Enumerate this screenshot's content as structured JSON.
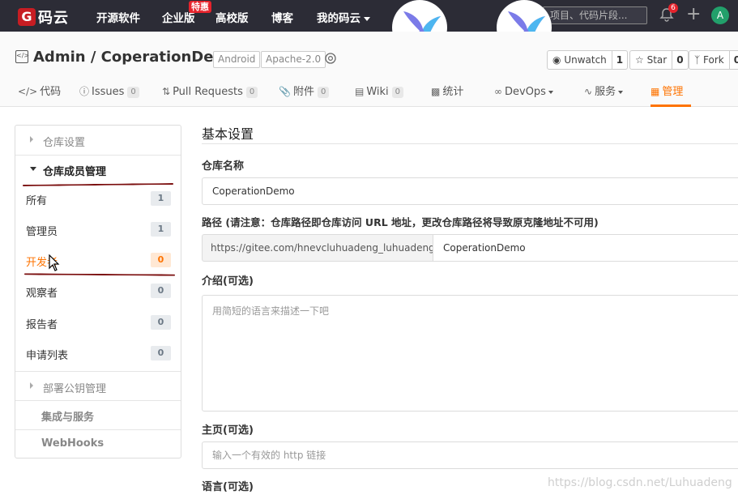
{
  "topnav": {
    "logo_mark": "G",
    "logo_text": "码云",
    "items": [
      "开源软件",
      "企业版",
      "高校版",
      "博客",
      "我的码云"
    ],
    "special_badge": "特惠",
    "search_placeholder": "项目、代码片段...",
    "notifications": "6",
    "avatar": "A"
  },
  "repo": {
    "title": "Admin / CoperationDemo",
    "tags": [
      "Android",
      "Apache-2.0"
    ],
    "actions": [
      {
        "label": "Unwatch",
        "count": "1"
      },
      {
        "label": "Star",
        "count": "0"
      },
      {
        "label": "Fork",
        "count": "0"
      }
    ]
  },
  "tabs": [
    {
      "label": "代码",
      "count": ""
    },
    {
      "label": "Issues",
      "count": "0"
    },
    {
      "label": "Pull Requests",
      "count": "0"
    },
    {
      "label": "附件",
      "count": "0"
    },
    {
      "label": "Wiki",
      "count": "0"
    },
    {
      "label": "统计",
      "count": ""
    },
    {
      "label": "DevOps",
      "count": ""
    },
    {
      "label": "服务",
      "count": ""
    },
    {
      "label": "管理",
      "count": ""
    }
  ],
  "sidebar": {
    "repo_settings": "仓库设置",
    "member_mgmt": "仓库成员管理",
    "members": [
      {
        "label": "所有",
        "count": "1"
      },
      {
        "label": "管理员",
        "count": "1"
      },
      {
        "label": "开发者",
        "count": "0"
      },
      {
        "label": "观察者",
        "count": "0"
      },
      {
        "label": "报告者",
        "count": "0"
      },
      {
        "label": "申请列表",
        "count": "0"
      }
    ],
    "deploy_keys": "部署公钥管理",
    "integrations": "集成与服务",
    "webhooks": "WebHooks"
  },
  "form": {
    "section_title": "基本设置",
    "name_label": "仓库名称",
    "name_value": "CoperationDemo",
    "path_label": "路径 (请注意：仓库路径即仓库访问 URL 地址，更改仓库路径将导致原克隆地址不可用)",
    "path_prefix": "https://gitee.com/hnevcluhuadeng_luhuadeng/",
    "path_value": "CoperationDemo",
    "desc_label": "介绍(可选)",
    "desc_placeholder": "用简短的语言来描述一下吧",
    "homepage_label": "主页(可选)",
    "homepage_placeholder": "输入一个有效的 http 链接",
    "language_label": "语言(可选)"
  },
  "watermark": "https://blog.csdn.net/Luhuadeng",
  "colors": {
    "accent": "#fe7300",
    "nav_bg": "#2c2c36",
    "brand_red": "#c71d23"
  }
}
